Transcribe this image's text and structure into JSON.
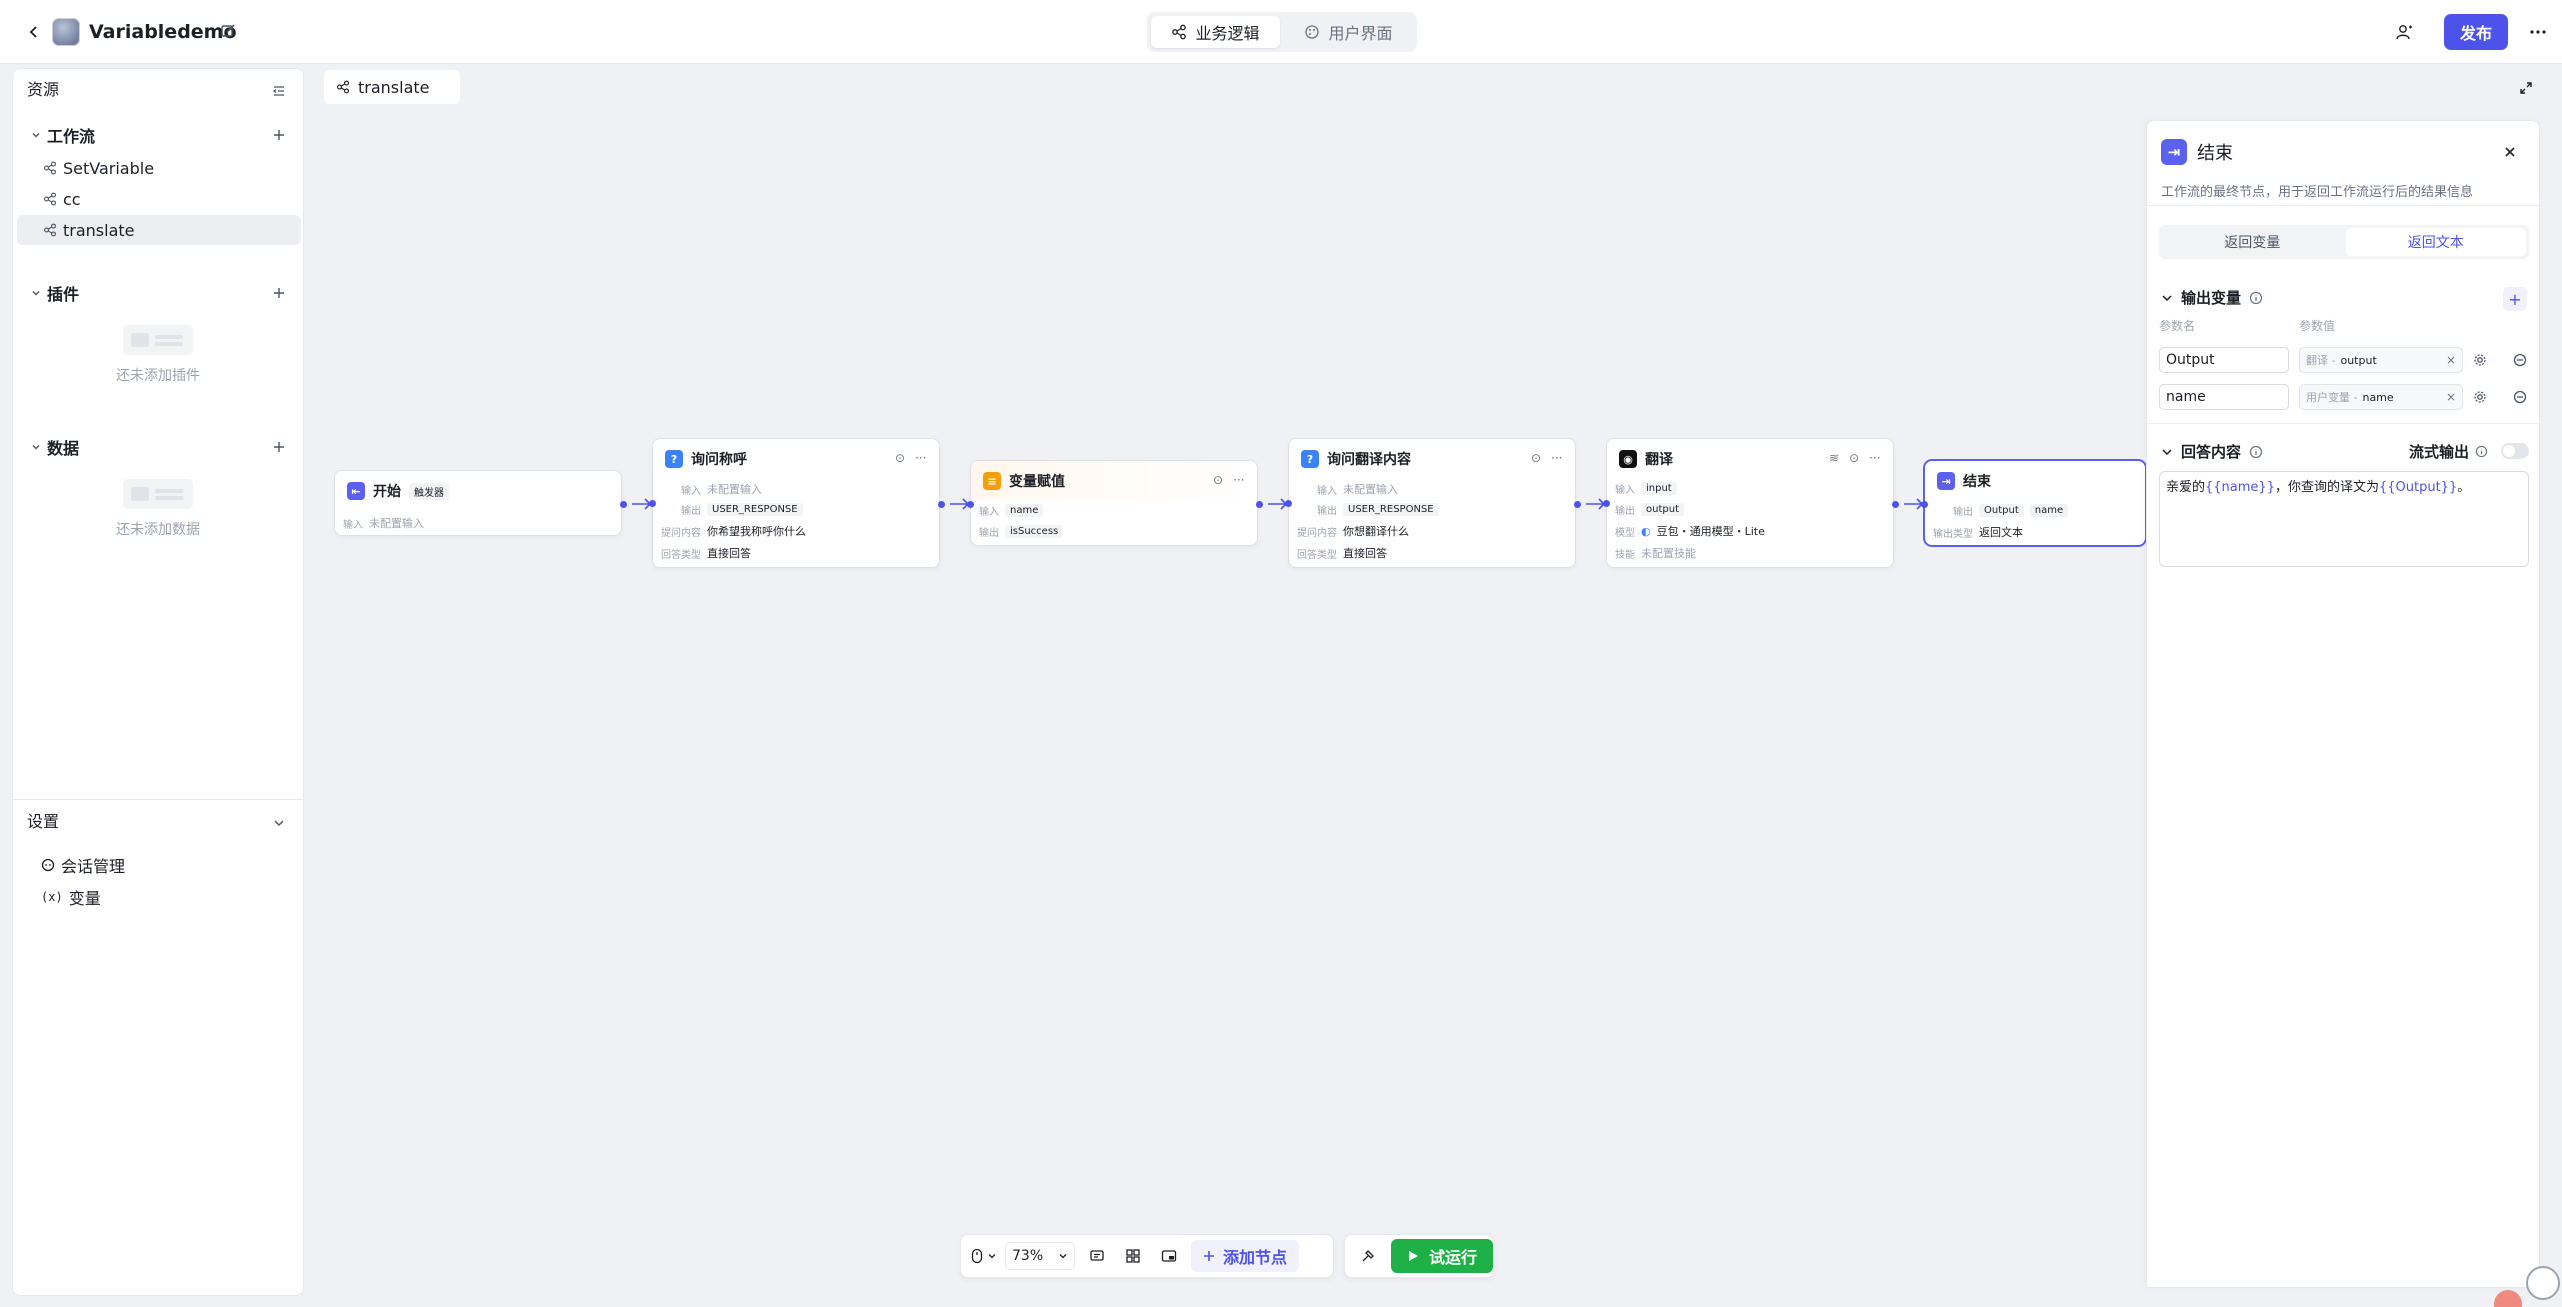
{
  "app": {
    "title": "Variabledemo",
    "publish_label": "发布"
  },
  "mode_tabs": [
    {
      "label": "业务逻辑",
      "active": true
    },
    {
      "label": "用户界面",
      "active": false
    }
  ],
  "sidebar": {
    "resources_label": "资源",
    "workflow_label": "工作流",
    "workflows": [
      {
        "label": "SetVariable"
      },
      {
        "label": "cc"
      },
      {
        "label": "translate",
        "selected": true
      }
    ],
    "plugins_label": "插件",
    "plugins_empty": "还未添加插件",
    "data_label": "数据",
    "data_empty": "还未添加数据",
    "settings_label": "设置",
    "settings_items": [
      {
        "label": "会话管理"
      },
      {
        "label": "变量"
      }
    ]
  },
  "canvas": {
    "tab_label": "translate",
    "nodes": {
      "start": {
        "title": "开始",
        "badge": "触发器",
        "input_label": "输入",
        "input_value": "未配置输入"
      },
      "ask_name": {
        "title": "询问称呼",
        "input_label": "输入",
        "input_value": "未配置输入",
        "output_label": "输出",
        "output_value": "USER_RESPONSE",
        "question_label": "提问内容",
        "question_value": "你希望我称呼你什么",
        "answer_label": "回答类型",
        "answer_value": "直接回答"
      },
      "assign": {
        "title": "变量赋值",
        "input_label": "输入",
        "input_value": "name",
        "output_label": "输出",
        "output_value": "isSuccess"
      },
      "ask_translate": {
        "title": "询问翻译内容",
        "input_label": "输入",
        "input_value": "未配置输入",
        "output_label": "输出",
        "output_value": "USER_RESPONSE",
        "question_label": "提问内容",
        "question_value": "你想翻译什么",
        "answer_label": "回答类型",
        "answer_value": "直接回答"
      },
      "translate": {
        "title": "翻译",
        "input_label": "输入",
        "input_value": "input",
        "output_label": "输出",
        "output_value": "output",
        "model_label": "模型",
        "model_value": "豆包・通用模型・Lite",
        "skill_label": "技能",
        "skill_value": "未配置技能"
      },
      "end": {
        "title": "结束",
        "output_label": "输出",
        "output_values": [
          "Output",
          "name"
        ],
        "type_label": "输出类型",
        "type_value": "返回文本"
      }
    }
  },
  "toolbar": {
    "zoom": "73%",
    "add_node_label": "添加节点",
    "test_run_label": "试运行"
  },
  "panel": {
    "title": "结束",
    "description": "工作流的最终节点，用于返回工作流运行后的结果信息",
    "tabs": [
      {
        "label": "返回变量",
        "active": false
      },
      {
        "label": "返回文本",
        "active": true
      }
    ],
    "output_section": "输出变量",
    "col_name": "参数名",
    "col_value": "参数值",
    "variables": [
      {
        "name": "Output",
        "source": "翻译 -",
        "ref": "output"
      },
      {
        "name": "name",
        "source": "用户变量 -",
        "ref": "name"
      }
    ],
    "answer_section": "回答内容",
    "stream_label": "流式输出",
    "answer_prefix": "亲爱的",
    "answer_var1": "{{name}}",
    "answer_mid": "，你查询的译文为",
    "answer_var2": "{{Output}}",
    "answer_suffix": "。"
  },
  "colors": {
    "accent": "#4d53e8",
    "run": "#1fb148",
    "question_node": "#3b82f6",
    "assign_node": "#f59e0b",
    "end_node": "#5b61ee"
  }
}
